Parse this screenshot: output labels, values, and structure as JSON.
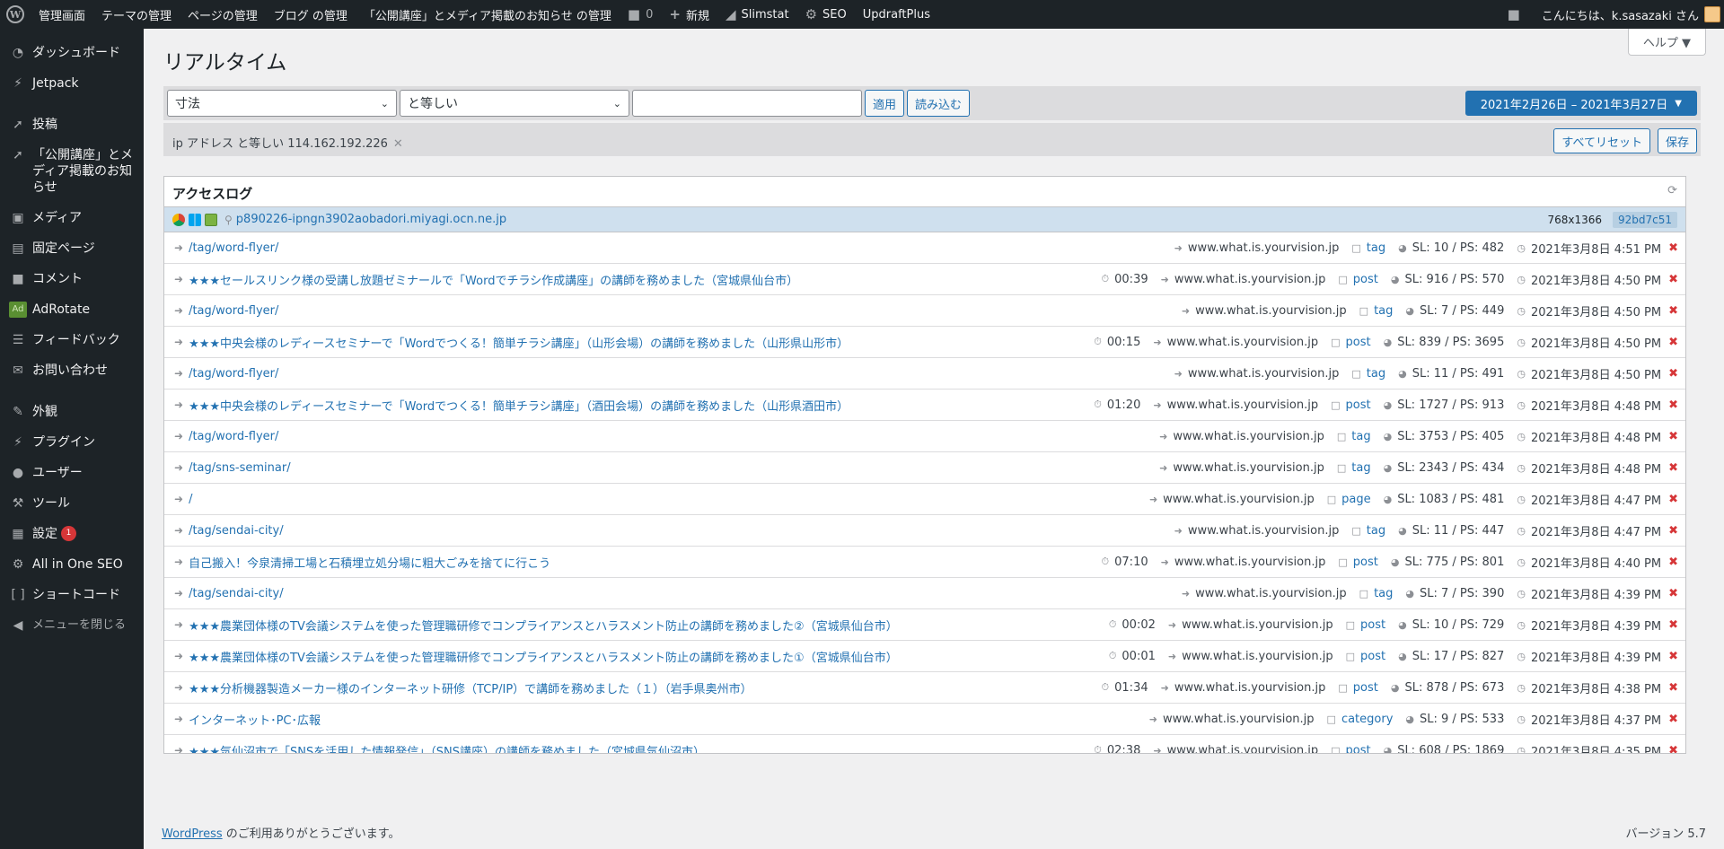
{
  "adminbar": {
    "items": [
      {
        "label": "管理画面"
      },
      {
        "label": "テーマの管理"
      },
      {
        "label": "ページの管理"
      },
      {
        "label": "ブログ の管理"
      },
      {
        "label": "「公開講座」とメディア掲載のお知らせ の管理"
      }
    ],
    "comments_count": "0",
    "new_label": "新規",
    "slimstat": "Slimstat",
    "seo": "SEO",
    "updraft": "UpdraftPlus",
    "greeting": "こんにちは、k.sasazaki さん"
  },
  "sidebar": {
    "items": [
      {
        "label": "ダッシュボード",
        "icon": "dashboard-icon"
      },
      {
        "label": "Jetpack",
        "icon": "jetpack-icon"
      },
      {
        "label": "投稿",
        "icon": "pin-icon"
      },
      {
        "label": "「公開講座」とメディア掲載のお知らせ",
        "icon": "pin-icon"
      },
      {
        "label": "メディア",
        "icon": "media-icon"
      },
      {
        "label": "固定ページ",
        "icon": "page-icon"
      },
      {
        "label": "コメント",
        "icon": "comment-icon"
      },
      {
        "label": "AdRotate",
        "icon": "adrotate-icon"
      },
      {
        "label": "フィードバック",
        "icon": "feedback-icon"
      },
      {
        "label": "お問い合わせ",
        "icon": "mail-icon"
      },
      {
        "label": "外観",
        "icon": "brush-icon"
      },
      {
        "label": "プラグイン",
        "icon": "plugin-icon"
      },
      {
        "label": "ユーザー",
        "icon": "user-icon"
      },
      {
        "label": "ツール",
        "icon": "wrench-icon"
      },
      {
        "label": "設定",
        "icon": "settings-icon",
        "badge": "1"
      },
      {
        "label": "All in One SEO",
        "icon": "aioseo-icon"
      },
      {
        "label": "ショートコード",
        "icon": "shortcode-icon"
      },
      {
        "label": "メニューを閉じる",
        "icon": "collapse-icon"
      }
    ]
  },
  "page": {
    "title": "リアルタイム",
    "help": "ヘルプ ▼"
  },
  "filters": {
    "dimension": "寸法",
    "operator": "と等しい",
    "value_placeholder": "",
    "apply": "適用",
    "load": "読み込む",
    "date_range": "2021年2月26日 – 2021年3月27日",
    "active_filter": "ip アドレス と等しい 114.162.192.226",
    "reset_all": "すべてリセット",
    "save": "保存"
  },
  "log": {
    "title": "アクセスログ",
    "visitor": {
      "host": "p890226-ipngn3902aobadori.miyagi.ocn.ne.jp",
      "resolution": "768x1366",
      "id": "92bd7c51"
    },
    "rows": [
      {
        "page": "/tag/word-flyer/",
        "duration": "",
        "referrer": "www.what.is.yourvision.jp",
        "type": "tag",
        "stats": "SL: 10 / PS: 482",
        "time": "2021年3月8日 4:51 PM"
      },
      {
        "page": "★★★セールスリンク様の受講し放題ゼミナールで「Wordでチラシ作成講座」の講師を務めました（宮城県仙台市）",
        "duration": "00:39",
        "referrer": "www.what.is.yourvision.jp",
        "type": "post",
        "stats": "SL: 916 / PS: 570",
        "time": "2021年3月8日 4:50 PM"
      },
      {
        "page": "/tag/word-flyer/",
        "duration": "",
        "referrer": "www.what.is.yourvision.jp",
        "type": "tag",
        "stats": "SL: 7 / PS: 449",
        "time": "2021年3月8日 4:50 PM"
      },
      {
        "page": "★★★中央会様のレディースセミナーで「Wordでつくる！簡単チラシ講座」（山形会場）の講師を務めました（山形県山形市）",
        "duration": "00:15",
        "referrer": "www.what.is.yourvision.jp",
        "type": "post",
        "stats": "SL: 839 / PS: 3695",
        "time": "2021年3月8日 4:50 PM"
      },
      {
        "page": "/tag/word-flyer/",
        "duration": "",
        "referrer": "www.what.is.yourvision.jp",
        "type": "tag",
        "stats": "SL: 11 / PS: 491",
        "time": "2021年3月8日 4:50 PM"
      },
      {
        "page": "★★★中央会様のレディースセミナーで「Wordでつくる！簡単チラシ講座」（酒田会場）の講師を務めました（山形県酒田市）",
        "duration": "01:20",
        "referrer": "www.what.is.yourvision.jp",
        "type": "post",
        "stats": "SL: 1727 / PS: 913",
        "time": "2021年3月8日 4:48 PM"
      },
      {
        "page": "/tag/word-flyer/",
        "duration": "",
        "referrer": "www.what.is.yourvision.jp",
        "type": "tag",
        "stats": "SL: 3753 / PS: 405",
        "time": "2021年3月8日 4:48 PM"
      },
      {
        "page": "/tag/sns-seminar/",
        "duration": "",
        "referrer": "www.what.is.yourvision.jp",
        "type": "tag",
        "stats": "SL: 2343 / PS: 434",
        "time": "2021年3月8日 4:48 PM"
      },
      {
        "page": "/",
        "duration": "",
        "referrer": "www.what.is.yourvision.jp",
        "type": "page",
        "stats": "SL: 1083 / PS: 481",
        "time": "2021年3月8日 4:47 PM"
      },
      {
        "page": "/tag/sendai-city/",
        "duration": "",
        "referrer": "www.what.is.yourvision.jp",
        "type": "tag",
        "stats": "SL: 11 / PS: 447",
        "time": "2021年3月8日 4:47 PM"
      },
      {
        "page": "自己搬入！今泉清掃工場と石積埋立処分場に粗大ごみを捨てに行こう",
        "duration": "07:10",
        "referrer": "www.what.is.yourvision.jp",
        "type": "post",
        "stats": "SL: 775 / PS: 801",
        "time": "2021年3月8日 4:40 PM"
      },
      {
        "page": "/tag/sendai-city/",
        "duration": "",
        "referrer": "www.what.is.yourvision.jp",
        "type": "tag",
        "stats": "SL: 7 / PS: 390",
        "time": "2021年3月8日 4:39 PM"
      },
      {
        "page": "★★★農業団体様のTV会議システムを使った管理職研修でコンプライアンスとハラスメント防止の講師を務めました②（宮城県仙台市）",
        "duration": "00:02",
        "referrer": "www.what.is.yourvision.jp",
        "type": "post",
        "stats": "SL: 10 / PS: 729",
        "time": "2021年3月8日 4:39 PM"
      },
      {
        "page": "★★★農業団体様のTV会議システムを使った管理職研修でコンプライアンスとハラスメント防止の講師を務めました①（宮城県仙台市）",
        "duration": "00:01",
        "referrer": "www.what.is.yourvision.jp",
        "type": "post",
        "stats": "SL: 17 / PS: 827",
        "time": "2021年3月8日 4:39 PM"
      },
      {
        "page": "★★★分析機器製造メーカー様のインターネット研修（TCP/IP）で講師を務めました（１）（岩手県奥州市）",
        "duration": "01:34",
        "referrer": "www.what.is.yourvision.jp",
        "type": "post",
        "stats": "SL: 878 / PS: 673",
        "time": "2021年3月8日 4:38 PM"
      },
      {
        "page": "インターネット･PC･広報",
        "duration": "",
        "referrer": "www.what.is.yourvision.jp",
        "type": "category",
        "stats": "SL: 9 / PS: 533",
        "time": "2021年3月8日 4:37 PM"
      },
      {
        "page": "★★★気仙沼市で「SNSを活用した情報発信」（SNS講座）の講師を務めました（宮城県気仙沼市）",
        "duration": "02:38",
        "referrer": "www.what.is.yourvision.jp",
        "type": "post",
        "stats": "SL: 608 / PS: 1869",
        "time": "2021年3月8日 4:35 PM"
      }
    ]
  },
  "footer": {
    "wp_link": "WordPress",
    "thanks": " のご利用ありがとうございます。",
    "version": "バージョン 5.7"
  }
}
